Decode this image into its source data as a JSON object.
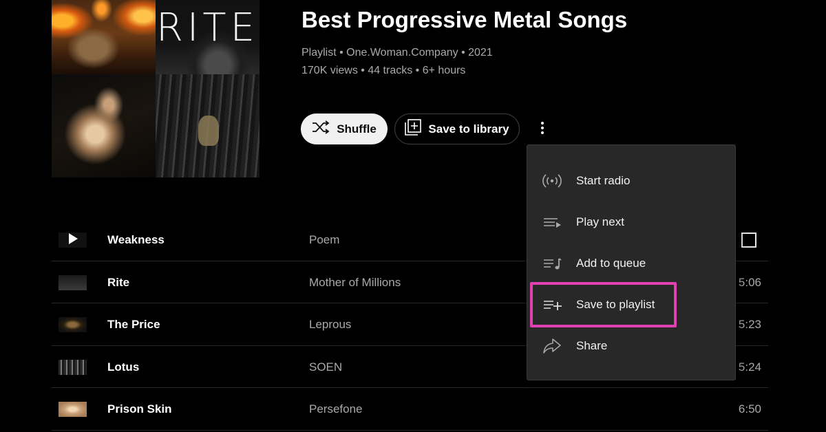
{
  "art": {
    "rite_text": "RITE"
  },
  "header": {
    "title": "Best Progressive Metal Songs",
    "meta_line1": "Playlist • One.Woman.Company • 2021",
    "meta_line2": "170K views • 44 tracks • 6+ hours"
  },
  "actions": {
    "shuffle_label": "Shuffle",
    "save_label": "Save to library"
  },
  "tracks": [
    {
      "title": "Weakness",
      "artist": "Poem",
      "duration": ""
    },
    {
      "title": "Rite",
      "artist": "Mother of Millions",
      "duration": "5:06"
    },
    {
      "title": "The Price",
      "artist": "Leprous",
      "duration": "5:23"
    },
    {
      "title": "Lotus",
      "artist": "SOEN",
      "duration": "5:24"
    },
    {
      "title": "Prison Skin",
      "artist": "Persefone",
      "duration": "6:50"
    }
  ],
  "menu": {
    "items": [
      {
        "label": "Start radio",
        "icon": "radio-icon"
      },
      {
        "label": "Play next",
        "icon": "play-next-icon"
      },
      {
        "label": "Add to queue",
        "icon": "add-to-queue-icon"
      },
      {
        "label": "Save to playlist",
        "icon": "playlist-add-icon"
      },
      {
        "label": "Share",
        "icon": "share-icon"
      }
    ],
    "highlighted_item": "Save to playlist"
  },
  "colors": {
    "background": "#000000",
    "menu_background": "#282828",
    "highlight": "#e040b0",
    "secondary_text": "#aaaaaa"
  }
}
